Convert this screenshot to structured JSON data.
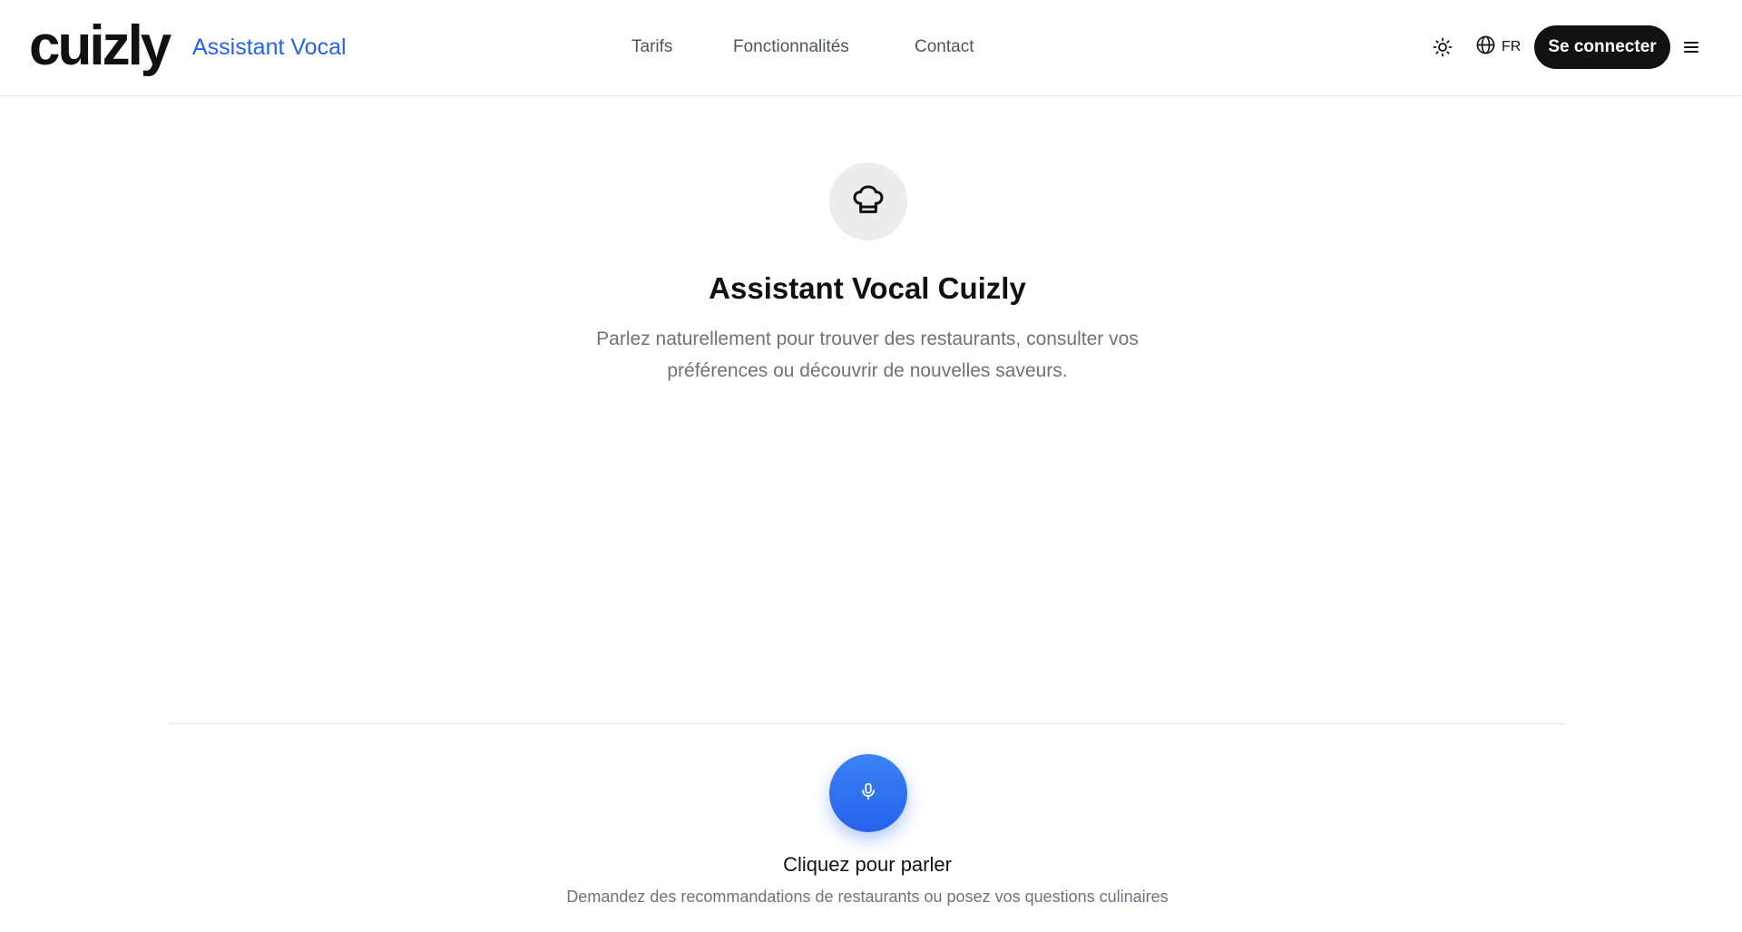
{
  "header": {
    "logo": "cuizly",
    "logo_subtitle": "Assistant Vocal",
    "nav": [
      {
        "label": "Tarifs"
      },
      {
        "label": "Fonctionnalités"
      },
      {
        "label": "Contact"
      }
    ],
    "theme_icon": "sun-icon",
    "language": {
      "icon": "globe-icon",
      "label": "FR"
    },
    "login_label": "Se connecter",
    "menu_icon": "hamburger-icon"
  },
  "hero": {
    "icon": "chef-hat-icon",
    "title": "Assistant Vocal Cuizly",
    "description": "Parlez naturellement pour trouver des restaurants, consulter vos préférences ou découvrir de nouvelles saveurs."
  },
  "voice": {
    "icon": "microphone-icon",
    "title": "Cliquez pour parler",
    "subtitle": "Demandez des recommandations de restaurants ou posez vos questions culinaires"
  },
  "colors": {
    "accent": "#2563eb",
    "button_dark": "#111111",
    "muted_text": "#6b7280",
    "icon_bg": "#ececec"
  }
}
